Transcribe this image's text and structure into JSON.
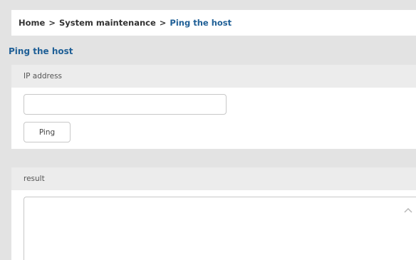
{
  "breadcrumb": {
    "home": "Home",
    "separator": ">",
    "parent": "System maintenance",
    "current": "Ping the host"
  },
  "page": {
    "title": "Ping the host"
  },
  "ip_section": {
    "header": "IP address",
    "input_value": "",
    "button_label": "Ping"
  },
  "result_section": {
    "header": "result",
    "value": ""
  },
  "colors": {
    "accent": "#1f5f96",
    "background": "#e3e3e3",
    "section_header": "#ececec"
  }
}
